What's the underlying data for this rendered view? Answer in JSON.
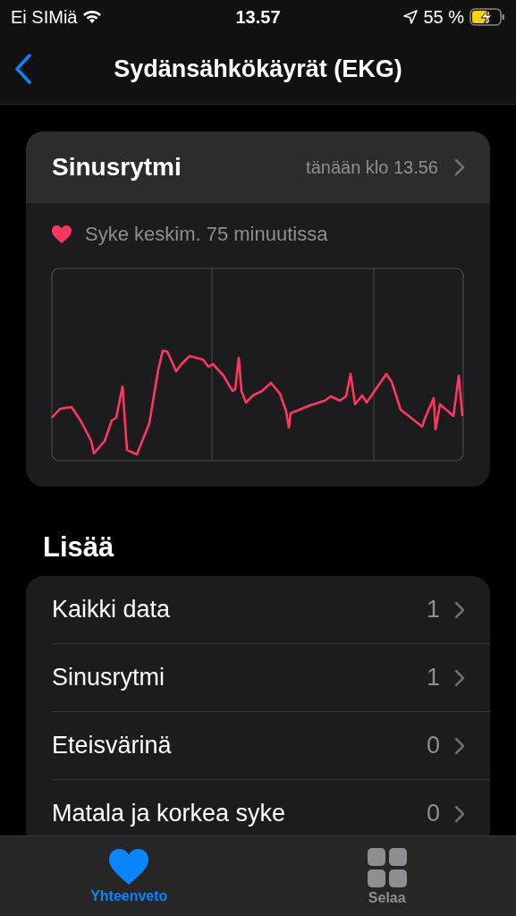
{
  "status_bar": {
    "carrier": "Ei SIMiä",
    "time": "13.57",
    "battery": "55 %"
  },
  "nav": {
    "title": "Sydänsähkökäyrät (EKG)"
  },
  "recording": {
    "title": "Sinusrytmi",
    "date": "tänään klo 13.56",
    "heart_rate": "Syke keskim. 75 minuutissa"
  },
  "more": {
    "heading": "Lisää",
    "rows": [
      {
        "label": "Kaikki data",
        "count": "1"
      },
      {
        "label": "Sinusrytmi",
        "count": "1"
      },
      {
        "label": "Eteisvärinä",
        "count": "0"
      },
      {
        "label": "Matala ja korkea syke",
        "count": "0"
      }
    ]
  },
  "tabs": [
    {
      "label": "Yhteenveto",
      "kind": "heart",
      "selected": true
    },
    {
      "label": "Selaa",
      "kind": "grid",
      "selected": false
    }
  ]
}
